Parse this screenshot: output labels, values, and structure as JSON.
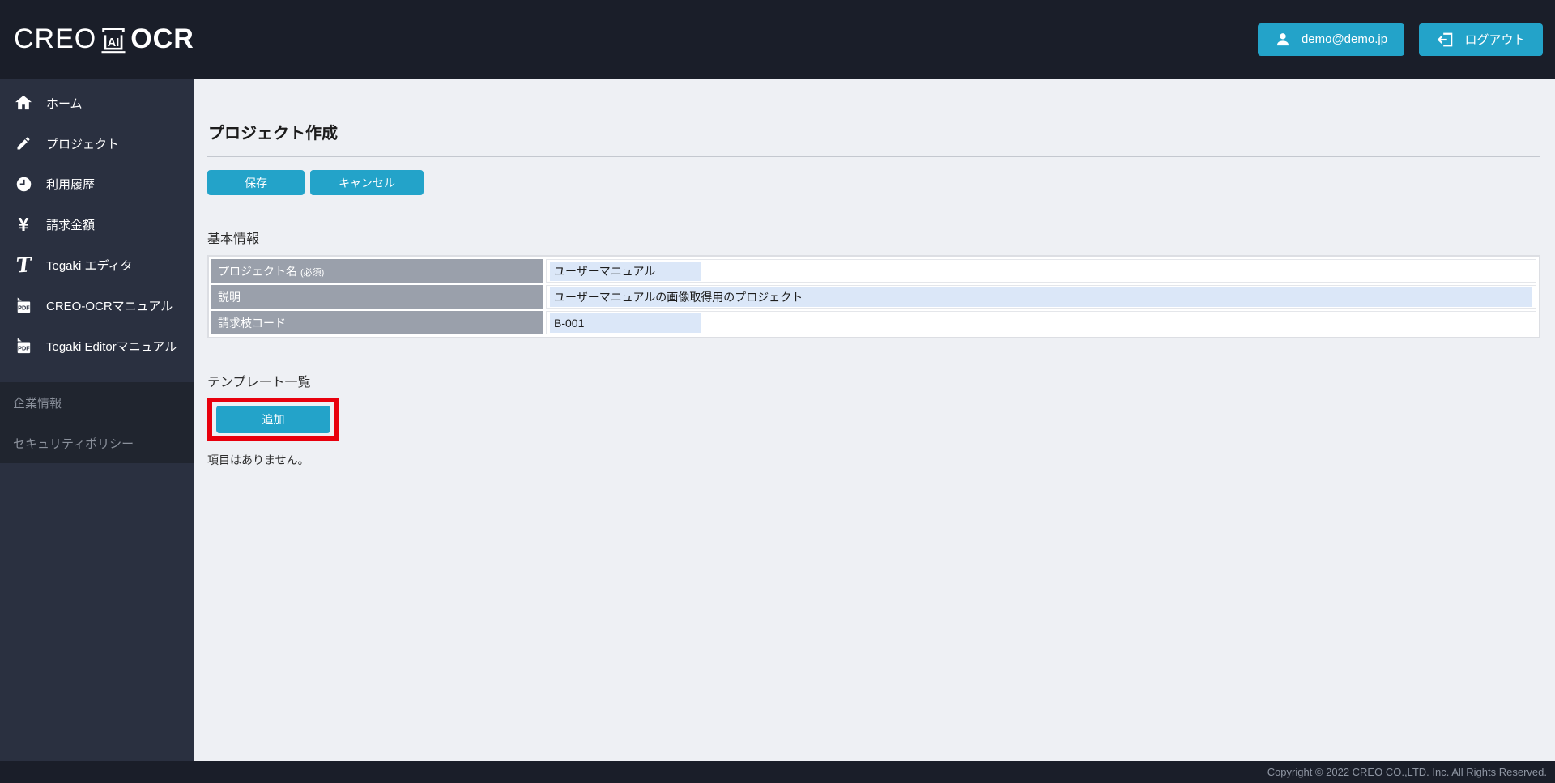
{
  "brand": {
    "name_left": "CREO",
    "logo_icon_text": "AI",
    "name_right": "OCR"
  },
  "header": {
    "user_email": "demo@demo.jp",
    "logout_label": "ログアウト"
  },
  "sidebar": {
    "items": [
      {
        "icon": "home-icon",
        "label": "ホーム"
      },
      {
        "icon": "pencil-icon",
        "label": "プロジェクト"
      },
      {
        "icon": "clock-icon",
        "label": "利用履歴"
      },
      {
        "icon": "yen-icon",
        "label": "請求金額"
      },
      {
        "icon": "tegaki-t-icon",
        "label": "Tegaki エディタ"
      },
      {
        "icon": "pdf-file-icon",
        "label": "CREO-OCRマニュアル"
      },
      {
        "icon": "pdf-file-icon",
        "label": "Tegaki Editorマニュアル"
      }
    ],
    "secondary_items": [
      {
        "label": "企業情報"
      },
      {
        "label": "セキュリティポリシー"
      }
    ]
  },
  "main": {
    "page_title": "プロジェクト作成",
    "save_label": "保存",
    "cancel_label": "キャンセル",
    "basic_info": {
      "heading": "基本情報",
      "rows": [
        {
          "label": "プロジェクト名",
          "note": "(必須)",
          "value": "ユーザーマニュアル"
        },
        {
          "label": "説明",
          "note": "",
          "value": "ユーザーマニュアルの画像取得用のプロジェクト"
        },
        {
          "label": "請求枝コード",
          "note": "",
          "value": "B-001"
        }
      ]
    },
    "template_section": {
      "heading": "テンプレート一覧",
      "add_label": "追加",
      "empty_message": "項目はありません。"
    }
  },
  "footer": {
    "copyright": "Copyright © 2022 CREO CO.,LTD. Inc. All Rights Reserved."
  },
  "icons": {
    "yen_glyph": "¥",
    "tegaki_glyph": "T",
    "pdf_label": "PDF"
  },
  "colors": {
    "accent_cyan": "#23a3c9",
    "highlight_red": "#e8000d",
    "header_bg": "#1a1e29",
    "sidebar_bg": "#2a3040",
    "sidebar_secondary_bg": "#20252f",
    "main_bg": "#eef0f4",
    "label_cell_bg": "#9aa0ab",
    "input_bg": "#dbe7f8",
    "footer_bg": "#1a1e29"
  }
}
